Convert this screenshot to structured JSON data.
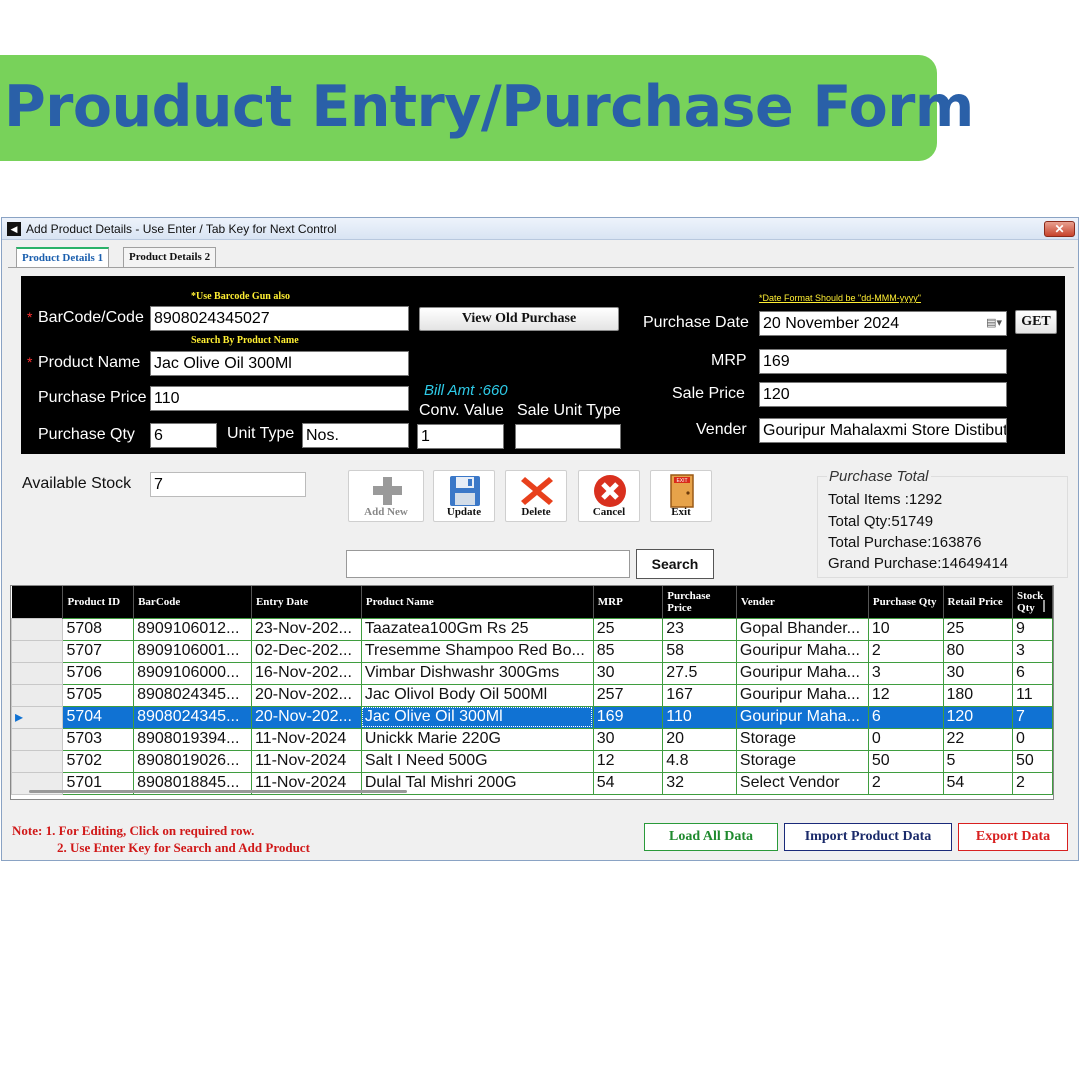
{
  "banner": {
    "title": "Prouduct Entry/Purchase Form"
  },
  "window": {
    "title": "Add Product Details - Use Enter / Tab Key for Next Control",
    "close_glyph": "✕",
    "app_icon_glyph": "◀"
  },
  "tabs": [
    {
      "label": "Product Details 1"
    },
    {
      "label": "Product Details 2"
    }
  ],
  "form": {
    "hint_barcode": "*Use Barcode Gun  also",
    "hint_search_name": "Search By Product Name",
    "hint_date": "*Date Format Should be \"dd-MMM-yyyy\"",
    "required_mark": "*",
    "barcode_label": "BarCode/Code",
    "barcode_value": "8908024345027",
    "product_name_label": "Product Name",
    "product_name_value": "Jac Olive Oil 300Ml",
    "purchase_price_label": "Purchase Price",
    "purchase_price_value": "110",
    "purchase_qty_label": "Purchase Qty",
    "purchase_qty_value": "6",
    "unit_type_label": "Unit Type",
    "unit_type_value": "Nos.",
    "view_old_purchase_label": "View Old Purchase",
    "bill_amt": "Bill Amt :660",
    "conv_value_label": "Conv. Value",
    "conv_value_value": "1",
    "sale_unit_type_label": "Sale Unit Type",
    "sale_unit_type_value": "",
    "purchase_date_label": "Purchase Date",
    "purchase_date_value": "20  November  2024",
    "get_label": "GET",
    "mrp_label": "MRP",
    "mrp_value": "169",
    "sale_price_label": "Sale Price",
    "sale_price_value": "120",
    "vender_label": "Vender",
    "vender_value": "Gouripur Mahalaxmi Store Distibutor"
  },
  "stock": {
    "label": "Available Stock",
    "value": "7"
  },
  "toolbar": [
    {
      "label": "Add New",
      "icon": "plus-icon"
    },
    {
      "label": "Update",
      "icon": "save-icon"
    },
    {
      "label": "Delete",
      "icon": "delete-icon"
    },
    {
      "label": "Cancel",
      "icon": "cancel-icon"
    },
    {
      "label": "Exit",
      "icon": "exit-door-icon"
    }
  ],
  "search": {
    "value": "",
    "button_label": "Search"
  },
  "totals": {
    "title": "Purchase Total",
    "total_items": "Total Items :1292",
    "total_qty": "Total Qty:51749",
    "total_purchase": "Total Purchase:163876",
    "grand_purchase": "Grand Purchase:14649414"
  },
  "grid": {
    "columns": [
      "Product ID",
      "BarCode",
      "Entry Date",
      "Product Name",
      "MRP",
      "Purchase Price",
      "Vender",
      "Purchase Qty",
      "Retail Price",
      "Stock Qty"
    ],
    "rows": [
      [
        "5708",
        "8909106012...",
        "23-Nov-202...",
        "Taazatea100Gm Rs 25",
        "25",
        "23",
        "Gopal Bhander...",
        "10",
        "25",
        "9"
      ],
      [
        "5707",
        "8909106001...",
        "02-Dec-202...",
        "Tresemme Shampoo Red Bo...",
        "85",
        "58",
        "Gouripur Maha...",
        "2",
        "80",
        "3"
      ],
      [
        "5706",
        "8909106000...",
        "16-Nov-202...",
        "Vimbar Dishwashr 300Gms",
        "30",
        "27.5",
        "Gouripur Maha...",
        "3",
        "30",
        "6"
      ],
      [
        "5705",
        "8908024345...",
        "20-Nov-202...",
        "Jac Olivol Body Oil 500Ml",
        "257",
        "167",
        "Gouripur Maha...",
        "12",
        "180",
        "11"
      ],
      [
        "5704",
        "8908024345...",
        "20-Nov-202...",
        "Jac Olive Oil 300Ml",
        "169",
        "110",
        "Gouripur Maha...",
        "6",
        "120",
        "7"
      ],
      [
        "5703",
        "8908019394...",
        "11-Nov-2024",
        "Unickk Marie 220G",
        "30",
        "20",
        "Storage",
        "0",
        "22",
        "0"
      ],
      [
        "5702",
        "8908019026...",
        "11-Nov-2024",
        "Salt I Need 500G",
        "12",
        "4.8",
        "Storage",
        "50",
        "5",
        "50"
      ],
      [
        "5701",
        "8908018845...",
        "11-Nov-2024",
        "Dulal Tal Mishri 200G",
        "54",
        "32",
        "Select Vendor",
        "2",
        "54",
        "2"
      ]
    ],
    "selected_row_index": 4,
    "row_pointer": "▸"
  },
  "notes": {
    "line1": "Note: 1. For Editing, Click on required row.",
    "line2": "2. Use Enter Key for Search and Add Product"
  },
  "bottom_buttons": {
    "load_all": "Load All Data",
    "import": "Import Product Data",
    "export": "Export Data"
  },
  "colors": {
    "banner_bg": "#78d25a",
    "banner_text": "#2a60a8",
    "selected_row": "#1072d3",
    "hint_yellow": "#ffef33",
    "bill_amt": "#2ecbe8",
    "note_red": "#d01818"
  }
}
